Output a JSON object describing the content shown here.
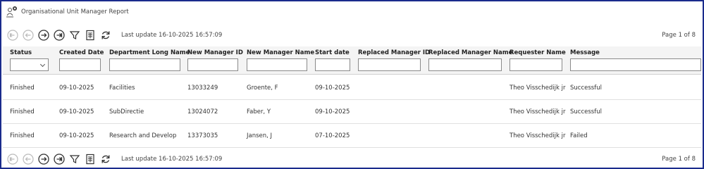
{
  "app": {
    "title": "Organisational Unit Manager Report"
  },
  "toolbar": {
    "last_update": "Last update 16-10-2025 16:57:09",
    "page_info": "Page 1 of 8"
  },
  "table": {
    "columns": [
      "Status",
      "Created Date",
      "Department Long Name",
      "New Manager ID",
      "New Manager Name",
      "Start date",
      "Replaced Manager ID",
      "Replaced Manager Name",
      "Requester Name",
      "Message"
    ],
    "rows": [
      [
        "Finished",
        "09-10-2025",
        "Facilities",
        "13033249",
        "Groente, F",
        "09-10-2025",
        "",
        "",
        "Theo Visschedijk jr",
        "Successful"
      ],
      [
        "Finished",
        "09-10-2025",
        "SubDirectie",
        "13024072",
        "Faber, Y",
        "09-10-2025",
        "",
        "",
        "Theo Visschedijk jr",
        "Successful"
      ],
      [
        "Finished",
        "09-10-2025",
        "Research and Develop",
        "13373035",
        "Jansen, J",
        "07-10-2025",
        "",
        "",
        "Theo Visschedijk jr",
        "Failed"
      ]
    ]
  },
  "icons": [
    "first-page-icon",
    "previous-page-icon",
    "next-page-icon",
    "last-page-icon",
    "filter-icon",
    "export-icon",
    "refresh-icon"
  ]
}
